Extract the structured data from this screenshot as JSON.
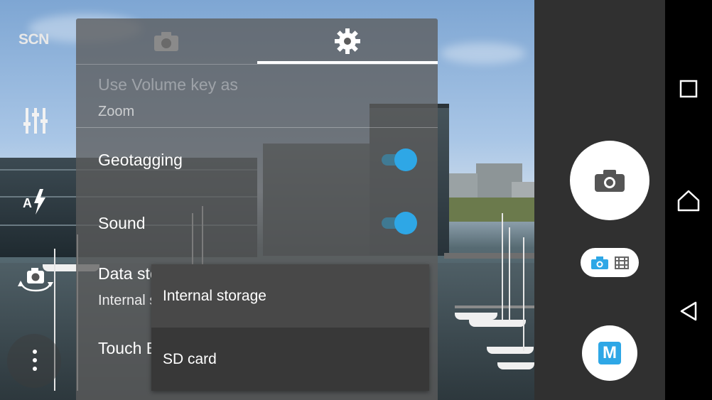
{
  "left_rail": {
    "scene_label": "SCN",
    "icons": [
      "scene-icon",
      "sliders-icon",
      "auto-flash-icon",
      "switch-camera-icon",
      "more-options-icon"
    ]
  },
  "settings": {
    "tabs": [
      {
        "icon": "camera-icon",
        "selected": false
      },
      {
        "icon": "gear-icon",
        "selected": true
      }
    ],
    "volume_key": {
      "title": "Use Volume key as",
      "value": "Zoom"
    },
    "geotagging": {
      "title": "Geotagging",
      "enabled": true
    },
    "sound": {
      "title": "Sound",
      "enabled": true
    },
    "data_storage": {
      "title": "Data storage",
      "value": "Internal storage"
    },
    "touch_block": {
      "title": "Touch Block"
    }
  },
  "storage_menu": {
    "options": [
      "Internal storage",
      "SD card"
    ]
  },
  "controls": {
    "shutter_icon": "camera-icon",
    "mode_icons": [
      "camera-icon",
      "video-icon"
    ],
    "manual_label": "M"
  },
  "nav": {
    "icons": [
      "recents-icon",
      "home-icon",
      "back-icon"
    ]
  },
  "colors": {
    "accent": "#2ea7e6",
    "panel": "#303030"
  }
}
